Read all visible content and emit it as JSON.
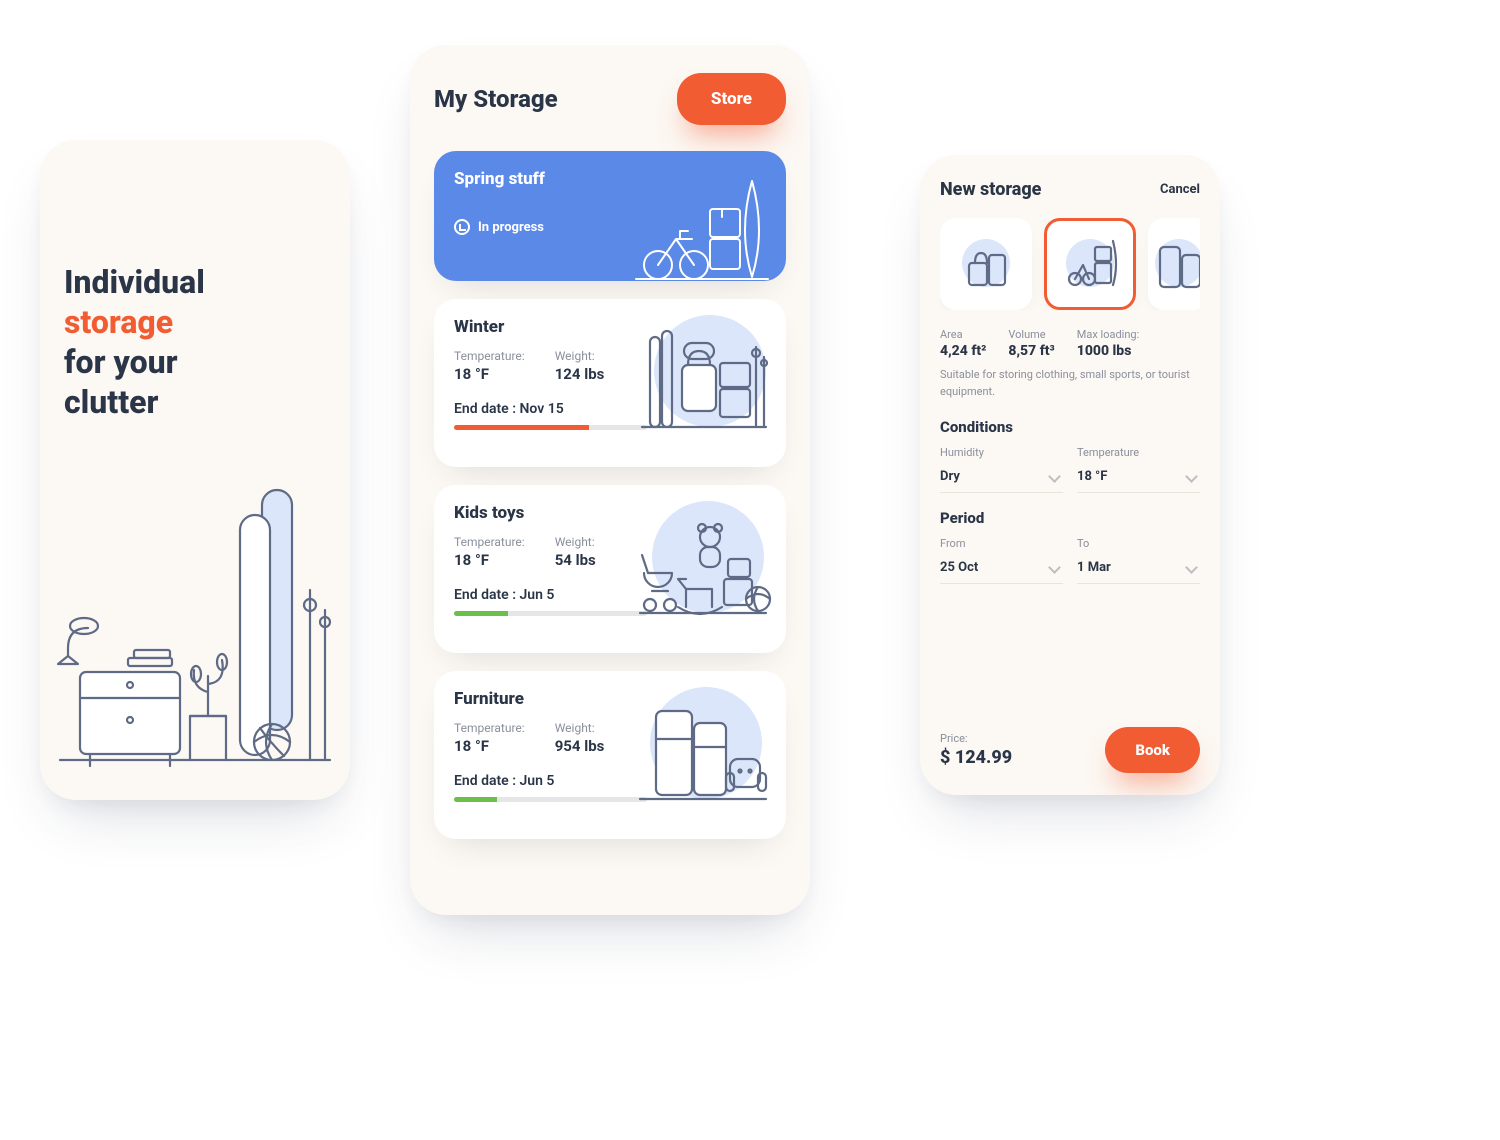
{
  "landing": {
    "headline_1": "Individual",
    "headline_2": "storage",
    "headline_3": "for your",
    "headline_4": "clutter"
  },
  "list": {
    "title": "My Storage",
    "cta": "Store",
    "metric_labels": {
      "temperature": "Temperature:",
      "weight": "Weight:"
    },
    "end_prefix": "End date : ",
    "cards": [
      {
        "name": "Spring stuff",
        "status": "In progress",
        "primary": true
      },
      {
        "name": "Winter",
        "temperature": "18 °F",
        "weight": "124 lbs",
        "end_date": "Nov 15",
        "progress_pct": 70,
        "bar_color": "#f25c33"
      },
      {
        "name": "Kids toys",
        "temperature": "18 °F",
        "weight": "54 lbs",
        "end_date": "Jun 5",
        "progress_pct": 28,
        "bar_color": "#6cc04a"
      },
      {
        "name": "Furniture",
        "temperature": "18 °F",
        "weight": "954 lbs",
        "end_date": "Jun 5",
        "progress_pct": 22,
        "bar_color": "#6cc04a"
      }
    ]
  },
  "form": {
    "title": "New storage",
    "cancel": "Cancel",
    "selected_tile_index": 1,
    "specs": {
      "area": {
        "label": "Area",
        "value": "4,24 ft²"
      },
      "volume": {
        "label": "Volume",
        "value": "8,57 ft³"
      },
      "max_loading": {
        "label": "Max loading:",
        "value": "1000 lbs"
      }
    },
    "description": "Suitable for storing clothing, small sports, or tourist equipment.",
    "sections": {
      "conditions": {
        "heading": "Conditions",
        "humidity": {
          "label": "Humidity",
          "value": "Dry"
        },
        "temperature": {
          "label": "Temperature",
          "value": "18 °F"
        }
      },
      "period": {
        "heading": "Period",
        "from": {
          "label": "From",
          "value": "25 Oct"
        },
        "to": {
          "label": "To",
          "value": "1 Mar"
        }
      }
    },
    "price": {
      "label": "Price:",
      "value": "$ 124.99"
    },
    "book": "Book"
  }
}
